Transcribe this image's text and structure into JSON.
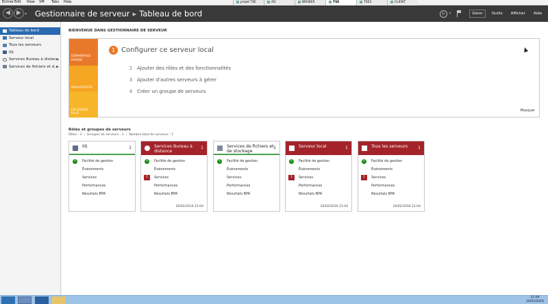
{
  "host": {
    "menu": [
      "Eichier",
      "Edit",
      "View",
      "VM",
      "Tabs",
      "Help"
    ],
    "tabs": [
      "projet TSE",
      "AD",
      "BROKER",
      "TSE",
      "TSE2",
      "CLIENT"
    ],
    "active_tab": 3
  },
  "titlebar": {
    "app_title": "Gestionnaire de serveur",
    "separator": "▸",
    "page_title": "Tableau de bord",
    "menu_manage": "Gérer",
    "menu_tools": "Outils",
    "menu_view": "Afficher",
    "menu_help": "Aide"
  },
  "sidebar": {
    "items": [
      {
        "label": "Tableau de bord",
        "icon": "dashboard-icon"
      },
      {
        "label": "Serveur local",
        "icon": "server-icon"
      },
      {
        "label": "Tous les serveurs",
        "icon": "servers-icon"
      },
      {
        "label": "IIS",
        "icon": "iis-icon"
      },
      {
        "label": "Services Bureau à distan...",
        "icon": "remote-desktop-icon"
      },
      {
        "label": "Services de fichiers et d...",
        "icon": "file-services-icon"
      }
    ]
  },
  "welcome_title": "BIENVENUE DANS GESTIONNAIRE DE SERVEUR",
  "quickstart": {
    "tile_1": "DÉMARRAGE RAPIDE",
    "tile_2": "NOUVEAUTÉS",
    "tile_3": "EN SAVOIR PLUS",
    "step_1_num": "1",
    "step_1": "Configurer ce serveur local",
    "steps": [
      {
        "num": "2",
        "label": "Ajouter des rôles et des fonctionnalités"
      },
      {
        "num": "3",
        "label": "Ajouter d'autres serveurs à gérer"
      },
      {
        "num": "4",
        "label": "Créer un groupe de serveurs"
      }
    ],
    "hide": "Masquer"
  },
  "roles": {
    "title": "Rôles et groupes de serveurs",
    "stat_roles": "Rôles : 3",
    "stat_groups": "Groupes de serveurs : 1",
    "stat_servers": "Nombre total de serveurs : 1"
  },
  "cards": [
    {
      "title": "IIS",
      "count": "1",
      "status": "ok",
      "rows": [
        "Facilité de gestion",
        "Événements",
        "Services",
        "Performances",
        "Résultats BPA"
      ],
      "services_badge": "",
      "time": ""
    },
    {
      "title": "Services Bureau à distance",
      "count": "1",
      "status": "error",
      "rows": [
        "Facilité de gestion",
        "Événements",
        "Services",
        "Performances",
        "Résultats BPA"
      ],
      "services_badge": "1",
      "time": "20/02/2016 21:04"
    },
    {
      "title": "Services de fichiers et de stockage",
      "count": "1",
      "status": "ok",
      "rows": [
        "Facilité de gestion",
        "Événements",
        "Services",
        "Performances",
        "Résultats BPA"
      ],
      "services_badge": "",
      "time": ""
    },
    {
      "title": "Serveur local",
      "count": "1",
      "status": "error",
      "rows": [
        "Facilité de gestion",
        "Événements",
        "Services",
        "Performances",
        "Résultats BPA"
      ],
      "services_badge": "1",
      "time": "20/02/2016 21:04"
    },
    {
      "title": "Tous les serveurs",
      "count": "1",
      "status": "error",
      "rows": [
        "Facilité de gestion",
        "Événements",
        "Services",
        "Performances",
        "Résultats BPA"
      ],
      "services_badge": "1",
      "time": "20/02/2016 21:04"
    }
  ],
  "taskbar": {
    "time": "21:04",
    "date": "20/02/2016"
  },
  "colors": {
    "accent_blue": "#2a6ab0",
    "quickstart_orange": "#e8792a",
    "error_red": "#a4232a",
    "ok_green": "#1a8b1a"
  }
}
